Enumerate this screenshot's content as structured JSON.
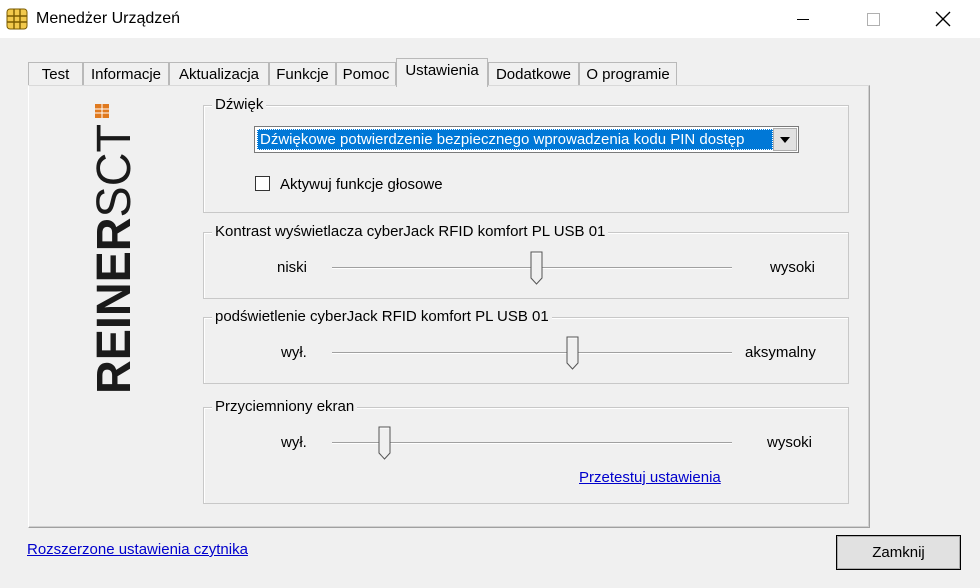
{
  "window": {
    "title": "Menedżer Urządzeń",
    "close_glyph": "✕"
  },
  "tabs": [
    {
      "label": "Test"
    },
    {
      "label": "Informacje"
    },
    {
      "label": "Aktualizacja"
    },
    {
      "label": "Funkcje"
    },
    {
      "label": "Pomoc"
    },
    {
      "label": "Ustawienia",
      "active": true
    },
    {
      "label": "Dodatkowe"
    },
    {
      "label": "O programie"
    }
  ],
  "logo": {
    "text": "REINERSCT"
  },
  "sound": {
    "group_title": "Dźwięk",
    "dropdown_value": "Dźwiękowe potwierdzenie bezpiecznego wprowadzenia kodu PIN dostęp",
    "checkbox_label": "Aktywuj funkcje głosowe",
    "checkbox_checked": false
  },
  "contrast": {
    "group_title": "Kontrast wyświetlacza cyberJack RFID komfort PL USB 01",
    "min_label": "niski",
    "max_label": "wysoki",
    "value_fraction": 0.51
  },
  "backlight": {
    "group_title": "podświetlenie cyberJack RFID komfort PL USB 01",
    "min_label": "wył.",
    "max_label": "aksymalny",
    "value_fraction": 0.6
  },
  "dimmed": {
    "group_title": "Przyciemniony ekran",
    "min_label": "wył.",
    "max_label": "wysoki",
    "value_fraction": 0.13,
    "test_link": "Przetestuj ustawienia"
  },
  "footer": {
    "advanced_link": "Rozszerzone ustawienia czytnika",
    "close_button": "Zamknij"
  }
}
